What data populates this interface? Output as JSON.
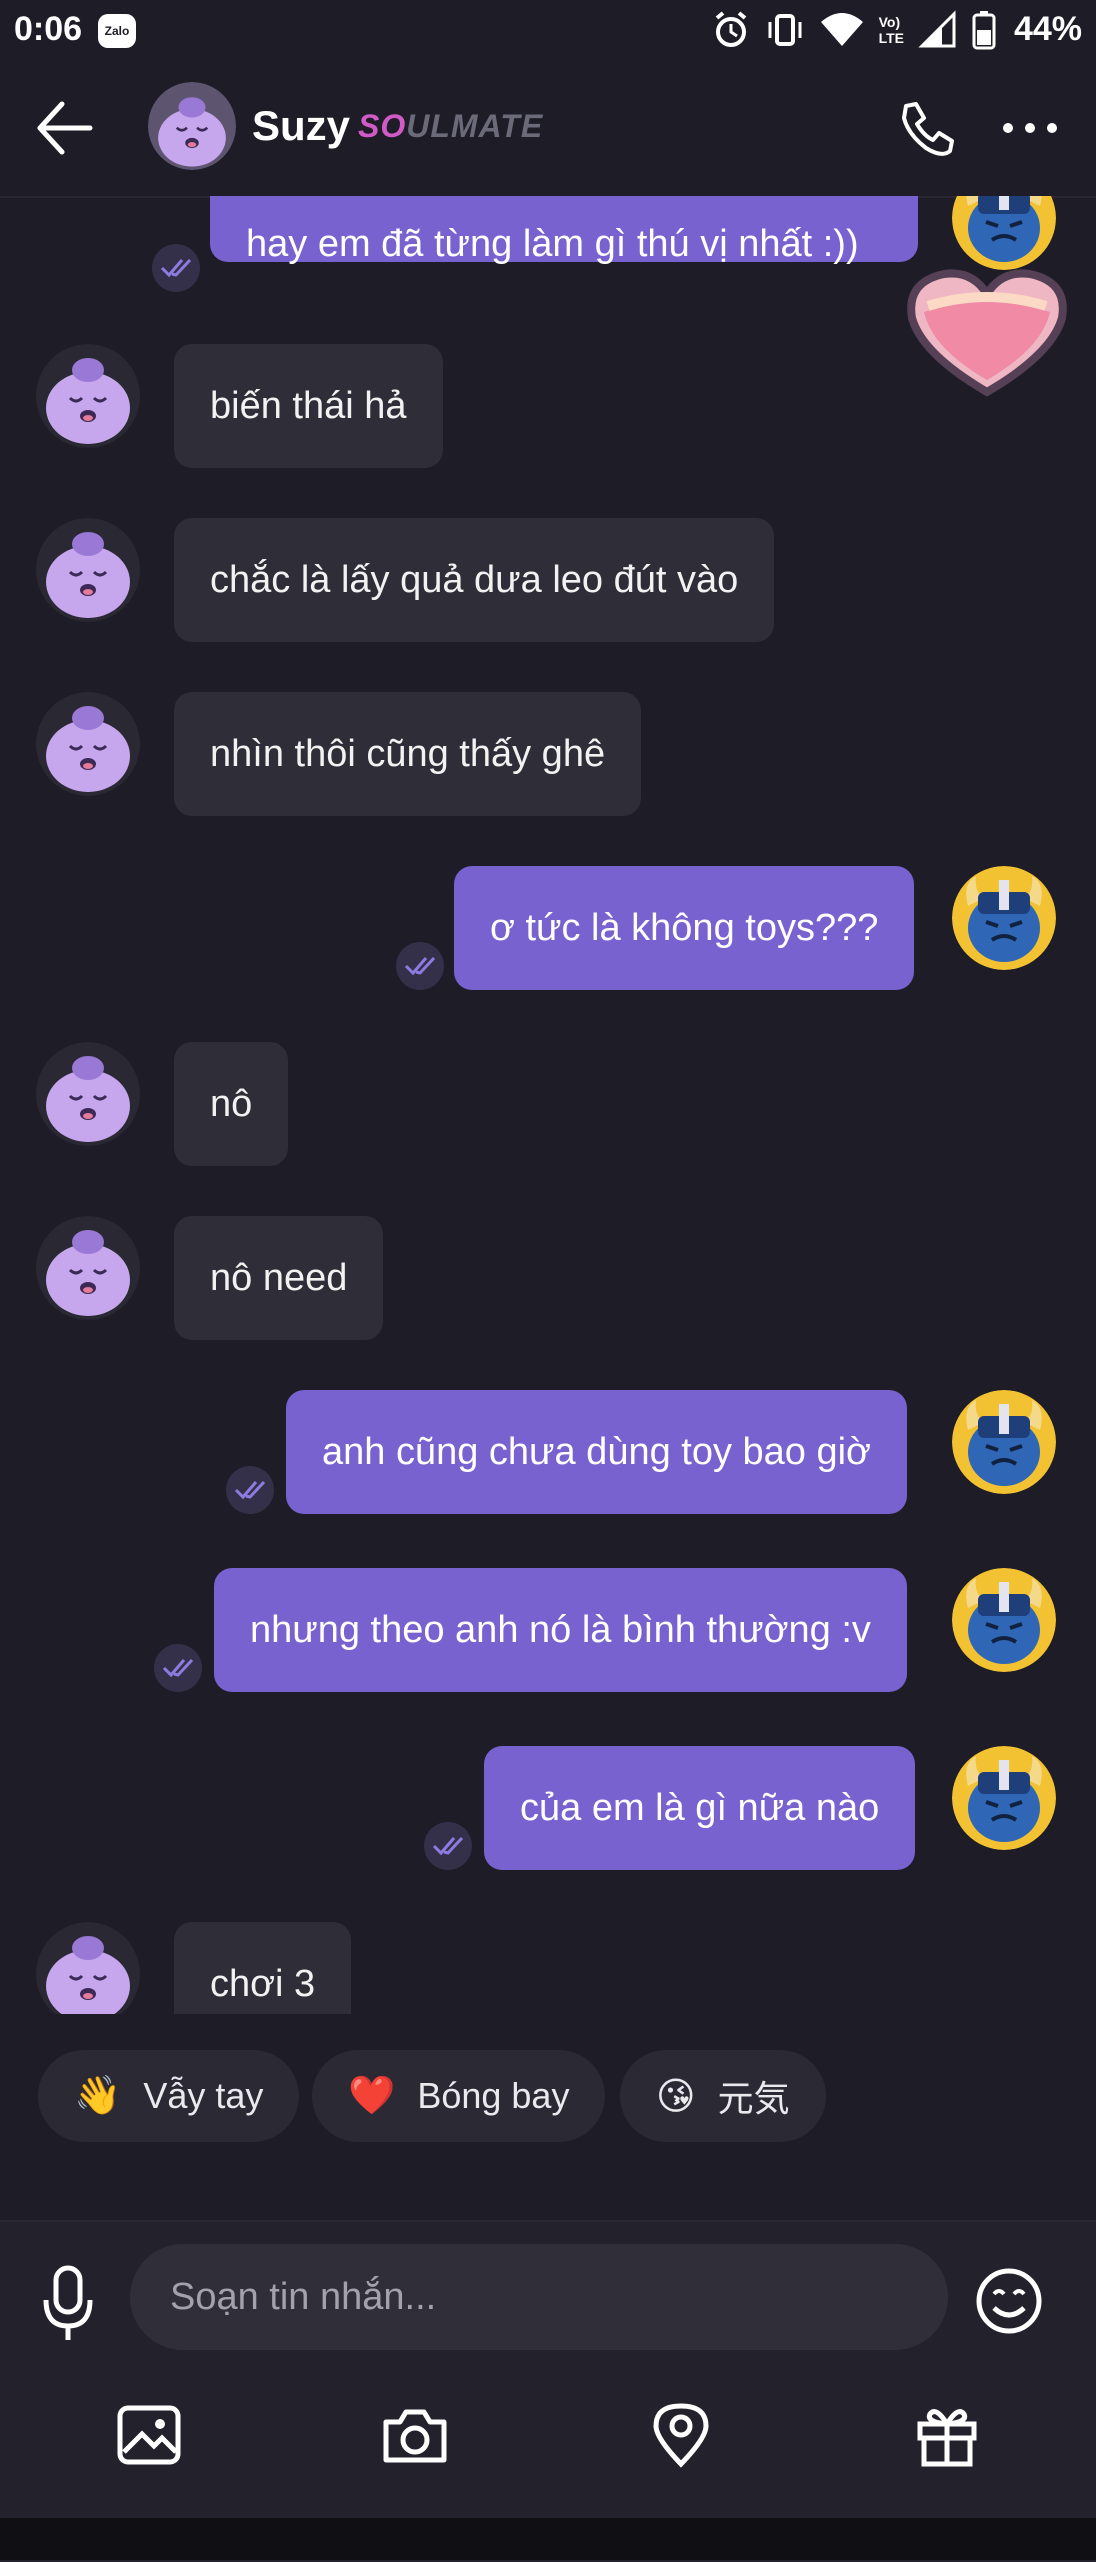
{
  "status_bar": {
    "time": "0:06",
    "notification_app": "Zalo",
    "network_label_top": "Vo)",
    "network_label_bottom": "LTE",
    "battery_percent": "44%"
  },
  "header": {
    "contact_name": "Suzy",
    "tag_part1": "SO",
    "tag_part2": "ULMATE"
  },
  "colors": {
    "background": "#1e1c27",
    "incoming_bubble": "#2f2d38",
    "outgoing_bubble": "#7862cf",
    "accent_pink": "#d15bc6"
  },
  "messages": [
    {
      "direction": "out",
      "text": "hay em đã từng làm gì thú vị nhất :))",
      "status": "read"
    },
    {
      "direction": "in",
      "text": "biến thái hả"
    },
    {
      "direction": "in",
      "text": "chắc là lấy quả dưa leo đút vào"
    },
    {
      "direction": "in",
      "text": "nhìn thôi cũng thấy ghê"
    },
    {
      "direction": "out",
      "text": "ơ tức là không toys???",
      "status": "read"
    },
    {
      "direction": "in",
      "text": "nô"
    },
    {
      "direction": "in",
      "text": "nô need"
    },
    {
      "direction": "out",
      "text": "anh cũng chưa dùng toy bao giờ",
      "status": "read"
    },
    {
      "direction": "out",
      "text": "nhưng theo anh nó là bình thường :v",
      "status": "read"
    },
    {
      "direction": "out",
      "text": "của em là gì nữa nào",
      "status": "read"
    },
    {
      "direction": "in",
      "text": "chơi 3"
    }
  ],
  "quick_replies": [
    {
      "emoji": "👋",
      "label": "Vẫy tay"
    },
    {
      "emoji": "❤️",
      "label": "Bóng bay"
    },
    {
      "emoji": "😘",
      "label": "元気"
    }
  ],
  "composer": {
    "placeholder": "Soạn tin nhắn..."
  },
  "icons": {
    "back": "arrow-left-icon",
    "call": "phone-icon",
    "more": "more-horizontal-icon",
    "mic": "microphone-icon",
    "emoji": "smiley-icon",
    "gallery": "image-icon",
    "camera": "camera-icon",
    "location": "location-pin-icon",
    "gift": "gift-icon",
    "heart_sticker": "heart-icon"
  }
}
